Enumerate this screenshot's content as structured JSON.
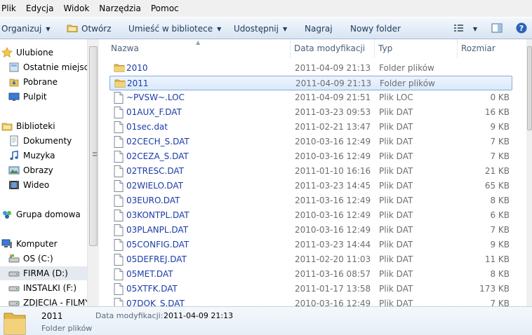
{
  "menu": [
    "Plik",
    "Edycja",
    "Widok",
    "Narzędzia",
    "Pomoc"
  ],
  "toolbar": {
    "organize": "Organizuj",
    "open": "Otwórz",
    "include_library": "Umieść w bibliotece",
    "share": "Udostępnij",
    "burn": "Nagraj",
    "new_folder": "Nowy folder"
  },
  "nav": {
    "favorites": "Ulubione",
    "recent": "Ostatnie miejsca",
    "downloads": "Pobrane",
    "desktop": "Pulpit",
    "libraries": "Biblioteki",
    "documents": "Dokumenty",
    "music": "Muzyka",
    "pictures": "Obrazy",
    "video": "Wideo",
    "homegroup": "Grupa domowa",
    "computer": "Komputer",
    "drive_c": "OS (C:)",
    "drive_d": "FIRMA (D:)",
    "drive_f": "INSTALKI (F:)",
    "drive_g": "ZDJECIA - FILMY"
  },
  "columns": {
    "name": "Nazwa",
    "date": "Data modyfikacji",
    "type": "Typ",
    "size": "Rozmiar"
  },
  "files": [
    {
      "name": "2010",
      "date": "2011-04-09 21:13",
      "type": "Folder plików",
      "size": "",
      "icon": "folder-icon"
    },
    {
      "name": "2011",
      "date": "2011-04-09 21:13",
      "type": "Folder plików",
      "size": "",
      "icon": "folder-icon",
      "selected": true
    },
    {
      "name": "~PVSW~.LOC",
      "date": "2011-04-09 21:51",
      "type": "Plik LOC",
      "size": "0 KB",
      "icon": "file-icon"
    },
    {
      "name": "01AUX_F.DAT",
      "date": "2011-03-23 09:53",
      "type": "Plik DAT",
      "size": "16 KB",
      "icon": "file-icon"
    },
    {
      "name": "01sec.dat",
      "date": "2011-02-21 13:47",
      "type": "Plik DAT",
      "size": "9 KB",
      "icon": "file-icon"
    },
    {
      "name": "02CECH_S.DAT",
      "date": "2010-03-16 12:49",
      "type": "Plik DAT",
      "size": "7 KB",
      "icon": "file-icon"
    },
    {
      "name": "02CEZA_S.DAT",
      "date": "2010-03-16 12:49",
      "type": "Plik DAT",
      "size": "7 KB",
      "icon": "file-icon"
    },
    {
      "name": "02TRESC.DAT",
      "date": "2011-01-10 16:16",
      "type": "Plik DAT",
      "size": "21 KB",
      "icon": "file-icon"
    },
    {
      "name": "02WIELO.DAT",
      "date": "2011-03-23 14:45",
      "type": "Plik DAT",
      "size": "65 KB",
      "icon": "file-icon"
    },
    {
      "name": "03EURO.DAT",
      "date": "2011-03-16 12:49",
      "type": "Plik DAT",
      "size": "8 KB",
      "icon": "file-icon"
    },
    {
      "name": "03KONTPL.DAT",
      "date": "2010-03-16 12:49",
      "type": "Plik DAT",
      "size": "6 KB",
      "icon": "file-icon"
    },
    {
      "name": "03PLANPL.DAT",
      "date": "2010-03-16 12:49",
      "type": "Plik DAT",
      "size": "7 KB",
      "icon": "file-icon"
    },
    {
      "name": "05CONFIG.DAT",
      "date": "2011-03-23 14:44",
      "type": "Plik DAT",
      "size": "9 KB",
      "icon": "file-icon"
    },
    {
      "name": "05DEFREJ.DAT",
      "date": "2011-02-20 11:03",
      "type": "Plik DAT",
      "size": "11 KB",
      "icon": "file-icon"
    },
    {
      "name": "05MET.DAT",
      "date": "2011-03-16 08:57",
      "type": "Plik DAT",
      "size": "8 KB",
      "icon": "file-icon"
    },
    {
      "name": "05XTFK.DAT",
      "date": "2011-01-17 13:58",
      "type": "Plik DAT",
      "size": "173 KB",
      "icon": "file-icon"
    },
    {
      "name": "07DOK_S.DAT",
      "date": "2010-03-16 12:49",
      "type": "Plik DAT",
      "size": "7 KB",
      "icon": "file-icon"
    }
  ],
  "details": {
    "name": "2011",
    "type": "Folder plików",
    "date_label": "Data modyfikacji:",
    "date_value": "2011-04-09 21:13"
  }
}
